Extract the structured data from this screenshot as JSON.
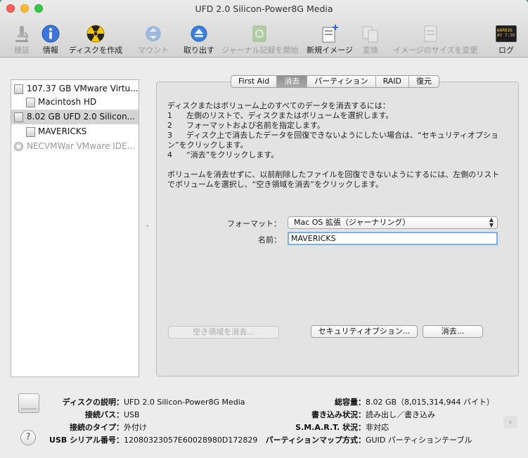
{
  "window": {
    "title": "UFD 2.0 Silicon-Power8G Media"
  },
  "toolbar": {
    "verify": "検証",
    "info": "情報",
    "burn": "ディスクを作成",
    "mount": "マウント",
    "eject": "取り出す",
    "journal": "ジャーナル記録を開始",
    "new_image": "新規イメージ",
    "convert": "変換",
    "resize_image": "イメージのサイズを変更",
    "log": "ログ",
    "log_icon_text_1": "WARNIN",
    "log_icon_text_2": "AY 7:36"
  },
  "sidebar": {
    "items": [
      {
        "label": "107.37 GB VMware Virtu..."
      },
      {
        "label": "Macintosh HD"
      },
      {
        "label": "8.02 GB UFD 2.0 Silicon..."
      },
      {
        "label": "MAVERICKS"
      },
      {
        "label": "NECVMWar VMware IDE..."
      }
    ]
  },
  "tabs": [
    {
      "label": "First Aid"
    },
    {
      "label": "消去"
    },
    {
      "label": "パーティション"
    },
    {
      "label": "RAID"
    },
    {
      "label": "復元"
    }
  ],
  "erase": {
    "intro": "ディスクまたはボリューム上のすべてのデータを消去するには：",
    "steps": [
      {
        "num": "1",
        "text": "左側のリストで、ディスクまたはボリュームを選択します。"
      },
      {
        "num": "2",
        "text": "フォーマットおよび名前を指定します。"
      },
      {
        "num": "3",
        "text": "ディスク上で消去したデータを回復できないようにしたい場合は、“セキュリティオプショ"
      },
      {
        "num": "",
        "text": "ン”をクリックします。"
      },
      {
        "num": "4",
        "text": "“消去”をクリックします。"
      }
    ],
    "note_line1": "ボリュームを消去せずに、以前削除したファイルを回復できないようにするには、左側のリスト",
    "note_line2": "でボリュームを選択し、“空き領域を消去”をクリックします。",
    "format_label": "フォーマット：",
    "format_value": "Mac OS 拡張（ジャーナリング）",
    "name_label": "名前：",
    "name_value": "MAVERICKS",
    "erase_free_button": "空き領域を消去...",
    "security_button": "セキュリティオプション...",
    "erase_button": "消去..."
  },
  "info": {
    "desc_label": "ディスクの説明：",
    "desc_value": "UFD 2.0 Silicon-Power8G Media",
    "bus_label": "接続バス：",
    "bus_value": "USB",
    "type_label": "接続のタイプ：",
    "type_value": "外付け",
    "serial_label": "USB シリアル番号：",
    "serial_value": "12080323057E60028980D172829",
    "capacity_label": "総容量：",
    "capacity_value": "8.02 GB（8,015,314,944 バイト）",
    "write_label": "書き込み状況：",
    "write_value": "読み出し／書き込み",
    "smart_label": "S.M.A.R.T. 状況：",
    "smart_value": "非対応",
    "partition_label": "パーティションマップ方式：",
    "partition_value": "GUID パーティションテーブル"
  },
  "help": {
    "symbol": "?"
  }
}
